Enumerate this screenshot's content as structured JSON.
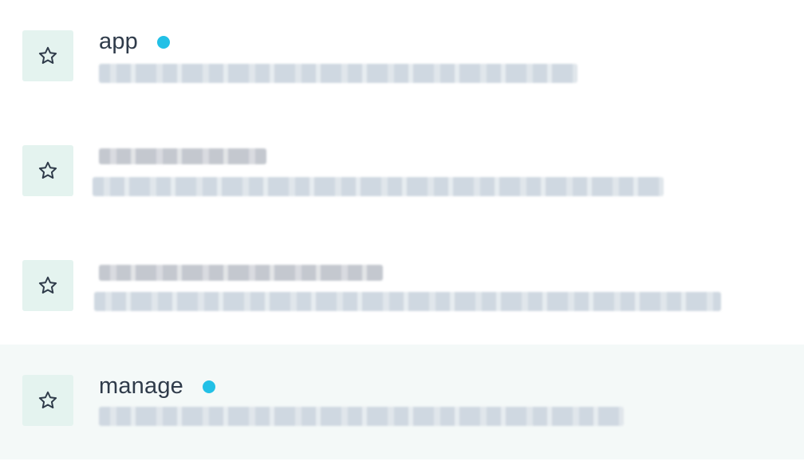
{
  "colors": {
    "tile_bg": "#e4f3ef",
    "star_stroke": "#2f3b4a",
    "status_dot": "#22c0e6",
    "highlight_row": "#f4f9f8"
  },
  "icons": {
    "favorite": "star-outline-icon"
  },
  "rows": [
    {
      "title": "app",
      "status_dot": true,
      "highlighted": false
    },
    {
      "title": "",
      "status_dot": false,
      "highlighted": false
    },
    {
      "title": "",
      "status_dot": false,
      "highlighted": false
    },
    {
      "title": "manage",
      "status_dot": true,
      "highlighted": true
    }
  ]
}
